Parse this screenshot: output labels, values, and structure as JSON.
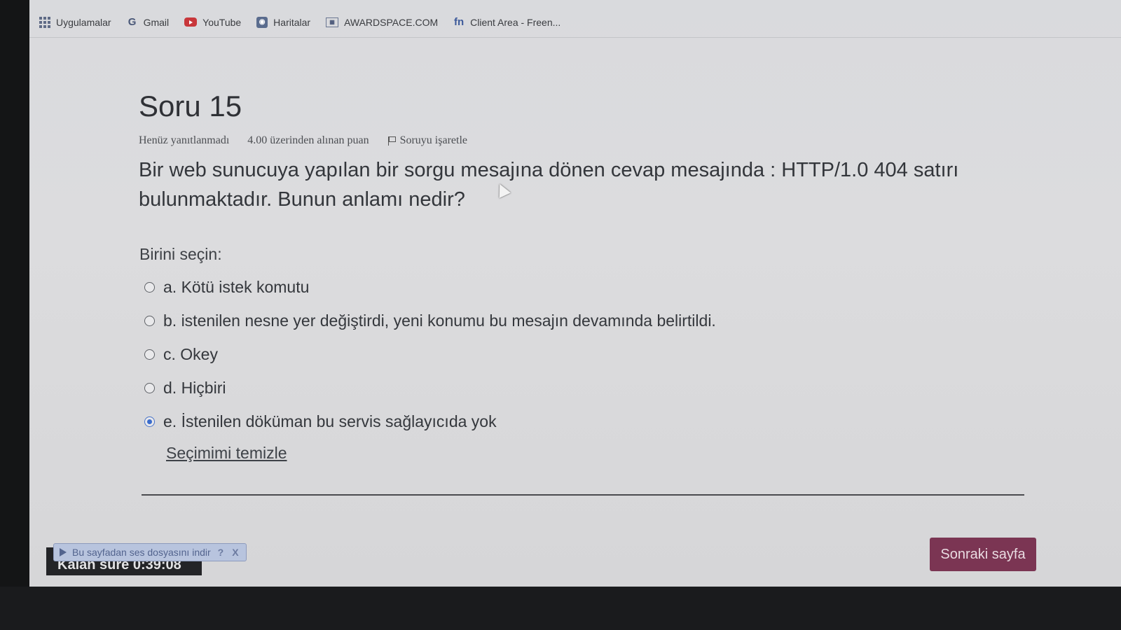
{
  "bookmarks": [
    {
      "label": "Uygulamalar",
      "icon": "apps-grid-icon"
    },
    {
      "label": "Gmail",
      "icon": "google-icon"
    },
    {
      "label": "YouTube",
      "icon": "youtube-icon"
    },
    {
      "label": "Haritalar",
      "icon": "maps-icon"
    },
    {
      "label": "AWARDSPACE.COM",
      "icon": "awardspace-icon"
    },
    {
      "label": "Client Area - Freen...",
      "icon": "freenom-icon"
    }
  ],
  "question": {
    "title": "Soru 15",
    "status": "Henüz yanıtlanmadı",
    "points": "4.00 üzerinden alınan puan",
    "flag_label": "Soruyu işaretle",
    "text": "Bir web sunucuya yapılan bir sorgu mesajına dönen cevap mesajında : HTTP/1.0 404 satırı bulunmaktadır. Bunun anlamı nedir?",
    "prompt": "Birini seçin:",
    "options": [
      {
        "label": "a. Kötü istek komutu",
        "selected": false
      },
      {
        "label": "b. istenilen nesne yer değiştirdi, yeni konumu bu mesajın devamında belirtildi.",
        "selected": false
      },
      {
        "label": "c. Okey",
        "selected": false
      },
      {
        "label": "d. Hiçbiri",
        "selected": false
      },
      {
        "label": "e. İstenilen döküman bu servis sağlayıcıda yok",
        "selected": true
      }
    ],
    "clear_label": "Seçimimi temizle"
  },
  "footer": {
    "timer_label": "Kalan süre 0:39:08",
    "audio_label": "Bu sayfadan ses dosyasını indir",
    "audio_help": "?",
    "audio_close": "X",
    "next_label": "Sonraki sayfa"
  },
  "colors": {
    "accent_button": "#7b3553",
    "selected_radio": "#3b6ccc"
  }
}
